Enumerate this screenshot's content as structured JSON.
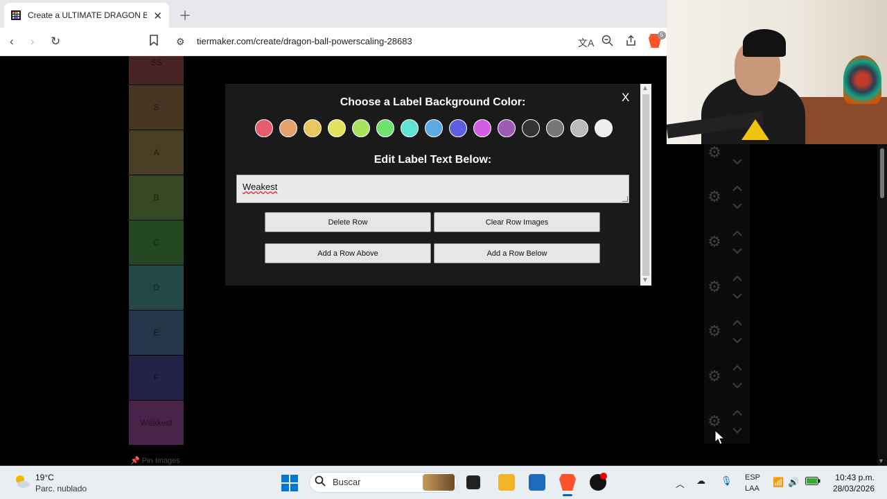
{
  "browser": {
    "tab_title": "Create a ULTIMATE DRAGON BALL",
    "url": "tiermaker.com/create/dragon-ball-powerscaling-28683",
    "extension_badge": "5"
  },
  "tiers": [
    {
      "label": "SS",
      "color": "#ff7f7f"
    },
    {
      "label": "S",
      "color": "#ffbf7f"
    },
    {
      "label": "A",
      "color": "#ffdf7f"
    },
    {
      "label": "B",
      "color": "#bfff7f"
    },
    {
      "label": "C",
      "color": "#7fff7f"
    },
    {
      "label": "D",
      "color": "#7fffff"
    },
    {
      "label": "E",
      "color": "#7fbfff"
    },
    {
      "label": "F",
      "color": "#7f7fff"
    },
    {
      "label": "Weakest",
      "color": "#ff7fff"
    }
  ],
  "pin_images_label": "Pin Images",
  "modal": {
    "close_label": "X",
    "color_heading": "Choose a Label Background Color:",
    "text_heading": "Edit Label Text Below:",
    "label_text_value": "Weakest",
    "swatch_colors": [
      "#e35d6a",
      "#e8a06a",
      "#e6c85e",
      "#e2e25e",
      "#a8e25e",
      "#6ee26e",
      "#5ee2d2",
      "#5ea8e2",
      "#5e5ee2",
      "#d25ee2",
      "#a05ab4",
      "#333333",
      "#777777",
      "#bbbbbb",
      "#eeeeee"
    ],
    "buttons": {
      "delete_row": "Delete Row",
      "clear_row_images": "Clear Row Images",
      "add_row_above": "Add a Row Above",
      "add_row_below": "Add a Row Below"
    }
  },
  "taskbar": {
    "weather_temp": "19°C",
    "weather_desc": "Parc. nublado",
    "search_placeholder": "Buscar",
    "lang_top": "ESP",
    "lang_bottom": "LAA",
    "time": "10:43 p.m.",
    "date": "28/03/2026"
  }
}
